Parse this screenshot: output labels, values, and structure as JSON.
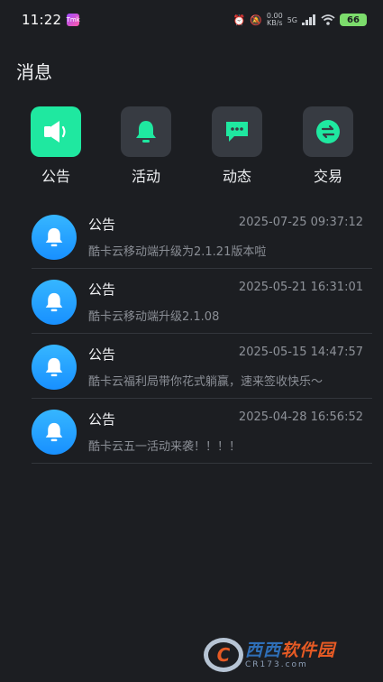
{
  "status_bar": {
    "time": "11:22",
    "app_icon_text": "Tmk",
    "net_speed_value": "0.00",
    "net_speed_unit": "KB/s",
    "signal_label": "5G",
    "battery": "66"
  },
  "page_title": "消息",
  "categories": [
    {
      "label": "公告",
      "icon": "speaker-icon",
      "active": true
    },
    {
      "label": "活动",
      "icon": "bell-icon",
      "active": false
    },
    {
      "label": "动态",
      "icon": "chat-bubble-icon",
      "active": false
    },
    {
      "label": "交易",
      "icon": "exchange-icon",
      "active": false
    }
  ],
  "messages": [
    {
      "title": "公告",
      "time": "2025-07-25 09:37:12",
      "text": "酷卡云移动端升级为2.1.21版本啦"
    },
    {
      "title": "公告",
      "time": "2025-05-21 16:31:01",
      "text": "酷卡云移动端升级2.1.08"
    },
    {
      "title": "公告",
      "time": "2025-05-15 14:47:57",
      "text": "酷卡云福利局带你花式躺赢，速来签收快乐～"
    },
    {
      "title": "公告",
      "time": "2025-04-28 16:56:52",
      "text": "酷卡云五一活动来袭！！！！"
    }
  ],
  "watermark": {
    "letter": "C",
    "name_part1": "西西",
    "name_part2": "软件园",
    "url": "CR173.com"
  },
  "colors": {
    "background": "#1c1e22",
    "accent_green": "#1fe8a0",
    "icon_tile": "#373b42",
    "avatar_blue": "#1890ff"
  }
}
